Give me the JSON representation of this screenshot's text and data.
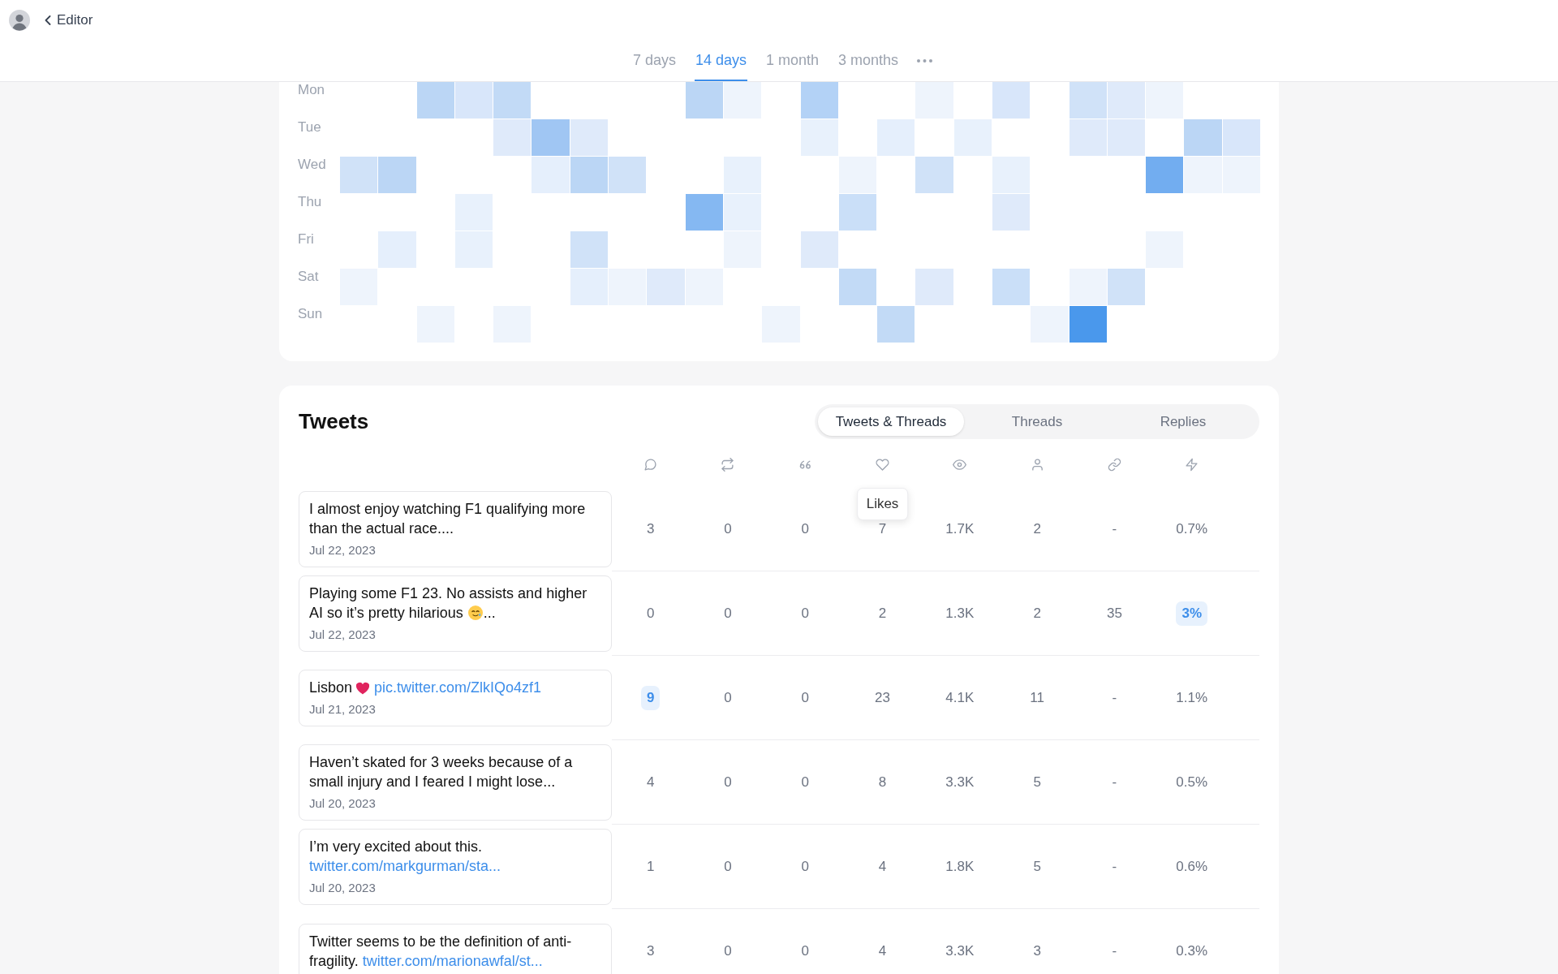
{
  "header": {
    "back": "Editor"
  },
  "period_tabs": [
    {
      "label": "7 days",
      "selected": false
    },
    {
      "label": "14 days",
      "selected": true
    },
    {
      "label": "1 month",
      "selected": false
    },
    {
      "label": "3 months",
      "selected": false
    }
  ],
  "heatmap": {
    "rows": [
      {
        "day": "Mon",
        "cells": [
          {
            "color": "#ffffff"
          },
          {
            "color": "#ffffff"
          },
          {
            "color": "#bbd6f5"
          },
          {
            "color": "#d8e6fa"
          },
          {
            "color": "#c2daf6"
          },
          {
            "color": "#ffffff"
          },
          {
            "color": "#ffffff"
          },
          {
            "color": "#ffffff"
          },
          {
            "color": "#ffffff"
          },
          {
            "color": "#bbd6f5"
          },
          {
            "color": "#eef4fc"
          },
          {
            "color": "#ffffff"
          },
          {
            "color": "#b3d2f6"
          },
          {
            "color": "#ffffff"
          },
          {
            "color": "#ffffff"
          },
          {
            "color": "#eef4fc"
          },
          {
            "color": "#ffffff"
          },
          {
            "color": "#d8e6fa"
          },
          {
            "color": "#ffffff"
          },
          {
            "color": "#d0e2f8"
          },
          {
            "color": "#dfeafa"
          },
          {
            "color": "#eef4fc"
          },
          {
            "color": "#ffffff"
          },
          {
            "color": "#ffffff"
          }
        ]
      },
      {
        "day": "Tue",
        "cells": [
          {
            "color": "#ffffff"
          },
          {
            "color": "#ffffff"
          },
          {
            "color": "#ffffff"
          },
          {
            "color": "#ffffff"
          },
          {
            "color": "#dfeafa"
          },
          {
            "color": "#a0c6f3"
          },
          {
            "color": "#dfeafa"
          },
          {
            "color": "#ffffff"
          },
          {
            "color": "#ffffff"
          },
          {
            "color": "#ffffff"
          },
          {
            "color": "#ffffff"
          },
          {
            "color": "#ffffff"
          },
          {
            "color": "#e8f1fc"
          },
          {
            "color": "#ffffff"
          },
          {
            "color": "#e5effc"
          },
          {
            "color": "#ffffff"
          },
          {
            "color": "#e8f1fc"
          },
          {
            "color": "#ffffff"
          },
          {
            "color": "#ffffff"
          },
          {
            "color": "#dfeafa"
          },
          {
            "color": "#dfeafa"
          },
          {
            "color": "#ffffff"
          },
          {
            "color": "#bbd6f5"
          },
          {
            "color": "#d8e6fa"
          }
        ]
      },
      {
        "day": "Wed",
        "cells": [
          {
            "color": "#d0e2f8"
          },
          {
            "color": "#bbd6f5"
          },
          {
            "color": "#ffffff"
          },
          {
            "color": "#ffffff"
          },
          {
            "color": "#ffffff"
          },
          {
            "color": "#e5effc"
          },
          {
            "color": "#bbd6f5"
          },
          {
            "color": "#d0e2f8"
          },
          {
            "color": "#ffffff"
          },
          {
            "color": "#ffffff"
          },
          {
            "color": "#e8f1fc"
          },
          {
            "color": "#ffffff"
          },
          {
            "color": "#ffffff"
          },
          {
            "color": "#eef4fc"
          },
          {
            "color": "#ffffff"
          },
          {
            "color": "#d0e2f8"
          },
          {
            "color": "#ffffff"
          },
          {
            "color": "#e8f1fc"
          },
          {
            "color": "#ffffff"
          },
          {
            "color": "#ffffff"
          },
          {
            "color": "#ffffff"
          },
          {
            "color": "#72adf0"
          },
          {
            "color": "#eef4fc"
          },
          {
            "color": "#eef4fc"
          }
        ]
      },
      {
        "day": "Thu",
        "cells": [
          {
            "color": "#ffffff"
          },
          {
            "color": "#ffffff"
          },
          {
            "color": "#ffffff"
          },
          {
            "color": "#e8f1fc"
          },
          {
            "color": "#ffffff"
          },
          {
            "color": "#ffffff"
          },
          {
            "color": "#ffffff"
          },
          {
            "color": "#ffffff"
          },
          {
            "color": "#ffffff"
          },
          {
            "color": "#85b8f2"
          },
          {
            "color": "#e8f1fc"
          },
          {
            "color": "#ffffff"
          },
          {
            "color": "#ffffff"
          },
          {
            "color": "#cadff8"
          },
          {
            "color": "#ffffff"
          },
          {
            "color": "#ffffff"
          },
          {
            "color": "#ffffff"
          },
          {
            "color": "#dfeafa"
          },
          {
            "color": "#ffffff"
          },
          {
            "color": "#ffffff"
          },
          {
            "color": "#ffffff"
          },
          {
            "color": "#ffffff"
          },
          {
            "color": "#ffffff"
          },
          {
            "color": "#ffffff"
          }
        ]
      },
      {
        "day": "Fri",
        "cells": [
          {
            "color": "#ffffff"
          },
          {
            "color": "#e5effc"
          },
          {
            "color": "#ffffff"
          },
          {
            "color": "#e8f1fc"
          },
          {
            "color": "#ffffff"
          },
          {
            "color": "#ffffff"
          },
          {
            "color": "#d0e2f8"
          },
          {
            "color": "#ffffff"
          },
          {
            "color": "#ffffff"
          },
          {
            "color": "#ffffff"
          },
          {
            "color": "#eef4fc"
          },
          {
            "color": "#ffffff"
          },
          {
            "color": "#dfeafa"
          },
          {
            "color": "#ffffff"
          },
          {
            "color": "#ffffff"
          },
          {
            "color": "#ffffff"
          },
          {
            "color": "#ffffff"
          },
          {
            "color": "#ffffff"
          },
          {
            "color": "#ffffff"
          },
          {
            "color": "#ffffff"
          },
          {
            "color": "#ffffff"
          },
          {
            "color": "#eef4fc"
          },
          {
            "color": "#ffffff"
          },
          {
            "color": "#ffffff"
          }
        ]
      },
      {
        "day": "Sat",
        "cells": [
          {
            "color": "#eef4fc"
          },
          {
            "color": "#ffffff"
          },
          {
            "color": "#ffffff"
          },
          {
            "color": "#ffffff"
          },
          {
            "color": "#ffffff"
          },
          {
            "color": "#ffffff"
          },
          {
            "color": "#e5effc"
          },
          {
            "color": "#eef4fc"
          },
          {
            "color": "#dfeafa"
          },
          {
            "color": "#eef4fc"
          },
          {
            "color": "#ffffff"
          },
          {
            "color": "#ffffff"
          },
          {
            "color": "#ffffff"
          },
          {
            "color": "#c2daf6"
          },
          {
            "color": "#ffffff"
          },
          {
            "color": "#dfeafa"
          },
          {
            "color": "#ffffff"
          },
          {
            "color": "#cadff8"
          },
          {
            "color": "#ffffff"
          },
          {
            "color": "#eef4fc"
          },
          {
            "color": "#d0e2f8"
          },
          {
            "color": "#ffffff"
          },
          {
            "color": "#ffffff"
          },
          {
            "color": "#ffffff"
          }
        ]
      },
      {
        "day": "Sun",
        "cells": [
          {
            "color": "#ffffff"
          },
          {
            "color": "#ffffff"
          },
          {
            "color": "#eef4fc"
          },
          {
            "color": "#ffffff"
          },
          {
            "color": "#eef4fc"
          },
          {
            "color": "#ffffff"
          },
          {
            "color": "#ffffff"
          },
          {
            "color": "#ffffff"
          },
          {
            "color": "#ffffff"
          },
          {
            "color": "#ffffff"
          },
          {
            "color": "#ffffff"
          },
          {
            "color": "#eef4fc"
          },
          {
            "color": "#ffffff"
          },
          {
            "color": "#ffffff"
          },
          {
            "color": "#c2daf6"
          },
          {
            "color": "#ffffff"
          },
          {
            "color": "#ffffff"
          },
          {
            "color": "#ffffff"
          },
          {
            "color": "#eef4fc"
          },
          {
            "color": "#4a98ec"
          },
          {
            "color": "#ffffff"
          },
          {
            "color": "#ffffff"
          },
          {
            "color": "#ffffff"
          },
          {
            "color": "#ffffff"
          }
        ]
      }
    ]
  },
  "tweets": {
    "title": "Tweets",
    "tabs": [
      {
        "label": "Tweets & Threads",
        "selected": true
      },
      {
        "label": "Threads",
        "selected": false
      },
      {
        "label": "Replies",
        "selected": false
      }
    ],
    "columns": [
      {
        "kind": "bubble"
      },
      {
        "kind": "arrows"
      },
      {
        "kind": "quote"
      },
      {
        "kind": "heart",
        "tooltip": "Likes"
      },
      {
        "kind": "eye"
      },
      {
        "kind": "person"
      },
      {
        "kind": "link"
      },
      {
        "kind": "bolt"
      }
    ],
    "rows": [
      {
        "parts": [
          {
            "kind": "text",
            "text": "I almost enjoy watching F1 qualifying more than the actual race...."
          }
        ],
        "date": "Jul 22, 2023",
        "cells": [
          {
            "text": "3",
            "highlighted": false
          },
          {
            "text": "0",
            "highlighted": false
          },
          {
            "text": "0",
            "highlighted": false
          },
          {
            "text": "7",
            "highlighted": false
          },
          {
            "text": "1.7K",
            "highlighted": false
          },
          {
            "text": "2",
            "highlighted": false
          },
          {
            "text": "-",
            "highlighted": false
          },
          {
            "text": "0.7%",
            "highlighted": false
          }
        ]
      },
      {
        "parts": [
          {
            "kind": "text",
            "text": "Playing some F1 23. No assists and higher AI so it’s pretty hilarious "
          },
          {
            "kind": "face"
          },
          {
            "kind": "text",
            "text": "..."
          }
        ],
        "date": "Jul 22, 2023",
        "cells": [
          {
            "text": "0",
            "highlighted": false
          },
          {
            "text": "0",
            "highlighted": false
          },
          {
            "text": "0",
            "highlighted": false
          },
          {
            "text": "2",
            "highlighted": false
          },
          {
            "text": "1.3K",
            "highlighted": false
          },
          {
            "text": "2",
            "highlighted": false
          },
          {
            "text": "35",
            "highlighted": false
          },
          {
            "text": "3%",
            "highlighted": true
          }
        ]
      },
      {
        "parts": [
          {
            "kind": "text",
            "text": "Lisbon "
          },
          {
            "kind": "heart"
          },
          {
            "kind": "link",
            "text": "pic.twitter.com/ZlkIQo4zf1"
          }
        ],
        "date": "Jul 21, 2023",
        "cells": [
          {
            "text": "9",
            "highlighted": true
          },
          {
            "text": "0",
            "highlighted": false
          },
          {
            "text": "0",
            "highlighted": false
          },
          {
            "text": "23",
            "highlighted": false
          },
          {
            "text": "4.1K",
            "highlighted": false
          },
          {
            "text": "11",
            "highlighted": false
          },
          {
            "text": "-",
            "highlighted": false
          },
          {
            "text": "1.1%",
            "highlighted": false
          }
        ]
      },
      {
        "parts": [
          {
            "kind": "text",
            "text": "Haven’t skated for 3 weeks because of a small injury and I feared I might lose..."
          }
        ],
        "date": "Jul 20, 2023",
        "cells": [
          {
            "text": "4",
            "highlighted": false
          },
          {
            "text": "0",
            "highlighted": false
          },
          {
            "text": "0",
            "highlighted": false
          },
          {
            "text": "8",
            "highlighted": false
          },
          {
            "text": "3.3K",
            "highlighted": false
          },
          {
            "text": "5",
            "highlighted": false
          },
          {
            "text": "-",
            "highlighted": false
          },
          {
            "text": "0.5%",
            "highlighted": false
          }
        ]
      },
      {
        "parts": [
          {
            "kind": "text",
            "text": "I’m very excited about this. "
          },
          {
            "kind": "link",
            "text": "twitter.com/markgurman/sta..."
          }
        ],
        "date": "Jul 20, 2023",
        "cells": [
          {
            "text": "1",
            "highlighted": false
          },
          {
            "text": "0",
            "highlighted": false
          },
          {
            "text": "0",
            "highlighted": false
          },
          {
            "text": "4",
            "highlighted": false
          },
          {
            "text": "1.8K",
            "highlighted": false
          },
          {
            "text": "5",
            "highlighted": false
          },
          {
            "text": "-",
            "highlighted": false
          },
          {
            "text": "0.6%",
            "highlighted": false
          }
        ]
      },
      {
        "parts": [
          {
            "kind": "text",
            "text": "Twitter seems to be the definition of anti-fragility. "
          },
          {
            "kind": "link",
            "text": "twitter.com/marionawfal/st..."
          }
        ],
        "cells": [
          {
            "text": "3",
            "highlighted": false
          },
          {
            "text": "0",
            "highlighted": false
          },
          {
            "text": "0",
            "highlighted": false
          },
          {
            "text": "4",
            "highlighted": false
          },
          {
            "text": "3.3K",
            "highlighted": false
          },
          {
            "text": "3",
            "highlighted": false
          },
          {
            "text": "-",
            "highlighted": false
          },
          {
            "text": "0.3%",
            "highlighted": false
          }
        ]
      }
    ]
  }
}
